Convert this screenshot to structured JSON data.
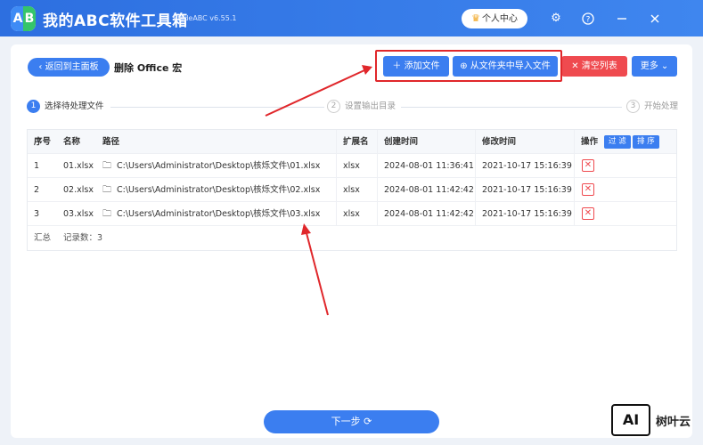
{
  "app": {
    "logo_a": "A",
    "logo_b": "B",
    "title": "我的ABC软件工具箱",
    "version": "WodeABC v6.55.1",
    "vip_label": "个人中心"
  },
  "titlebar_icons": [
    "gear-icon",
    "help-icon",
    "minimize-icon",
    "close-icon"
  ],
  "toolbar": {
    "back_label": "返回到主面板",
    "page_title": "删除 Office 宏",
    "add_file_label": "添加文件",
    "import_folder_label": "从文件夹中导入文件",
    "clear_list_label": "清空列表",
    "more_label": "更多"
  },
  "steps": [
    {
      "num": "1",
      "label": "选择待处理文件"
    },
    {
      "num": "2",
      "label": "设置输出目录"
    },
    {
      "num": "3",
      "label": "开始处理"
    }
  ],
  "table": {
    "headers": {
      "idx": "序号",
      "name": "名称",
      "path": "路径",
      "ext": "扩展名",
      "ctime": "创建时间",
      "mtime": "修改时间",
      "op": "操作",
      "filter": "过 滤",
      "sort": "排 序"
    },
    "rows": [
      {
        "idx": "1",
        "name": "01.xlsx",
        "path": "C:\\Users\\Administrator\\Desktop\\核烁文件\\01.xlsx",
        "ext": "xlsx",
        "ctime": "2024-08-01 11:36:41",
        "mtime": "2021-10-17 15:16:39"
      },
      {
        "idx": "2",
        "name": "02.xlsx",
        "path": "C:\\Users\\Administrator\\Desktop\\核烁文件\\02.xlsx",
        "ext": "xlsx",
        "ctime": "2024-08-01 11:42:42",
        "mtime": "2021-10-17 15:16:39"
      },
      {
        "idx": "3",
        "name": "03.xlsx",
        "path": "C:\\Users\\Administrator\\Desktop\\核烁文件\\03.xlsx",
        "ext": "xlsx",
        "ctime": "2024-08-01 11:42:42",
        "mtime": "2021-10-17 15:16:39"
      }
    ],
    "summary_label": "汇总",
    "summary_count": "记录数：3"
  },
  "next_label": "下一步",
  "watermark": {
    "box": "AI",
    "text": "树叶云"
  },
  "colors": {
    "primary": "#3b7ef0",
    "danger": "#ef4a4f",
    "highlight": "#e0272b"
  }
}
